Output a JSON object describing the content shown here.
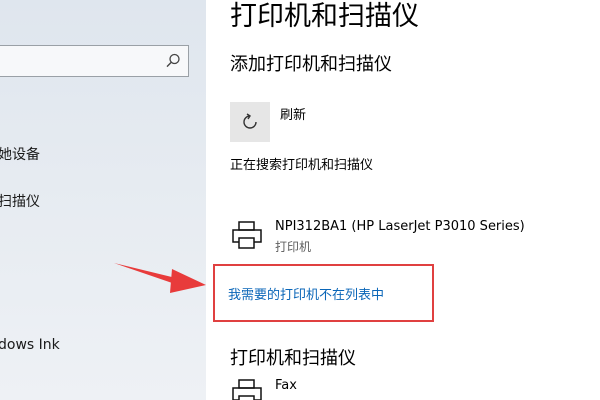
{
  "sidebar": {
    "search": {
      "placeholder": ""
    },
    "items": [
      {
        "label": "她设备"
      },
      {
        "label": "扫描仪"
      },
      {
        "label": "dows Ink"
      }
    ]
  },
  "main": {
    "page_title": "打印机和扫描仪",
    "add_section_title": "添加打印机和扫描仪",
    "refresh_label": "刷新",
    "searching_text": "正在搜索打印机和扫描仪",
    "found_printer": {
      "name": "NPI312BA1 (HP LaserJet P3010 Series)",
      "type": "打印机"
    },
    "not_listed_link": "我需要的打印机不在列表中",
    "list_section_title": "打印机和扫描仪",
    "printers": [
      {
        "name": "Fax"
      }
    ]
  },
  "colors": {
    "link": "#0a66b8",
    "highlight_border": "#e04040",
    "arrow": "#e83b3b"
  },
  "icons": [
    "search-icon",
    "refresh-icon",
    "printer-icon",
    "arrow-annotation-icon"
  ]
}
